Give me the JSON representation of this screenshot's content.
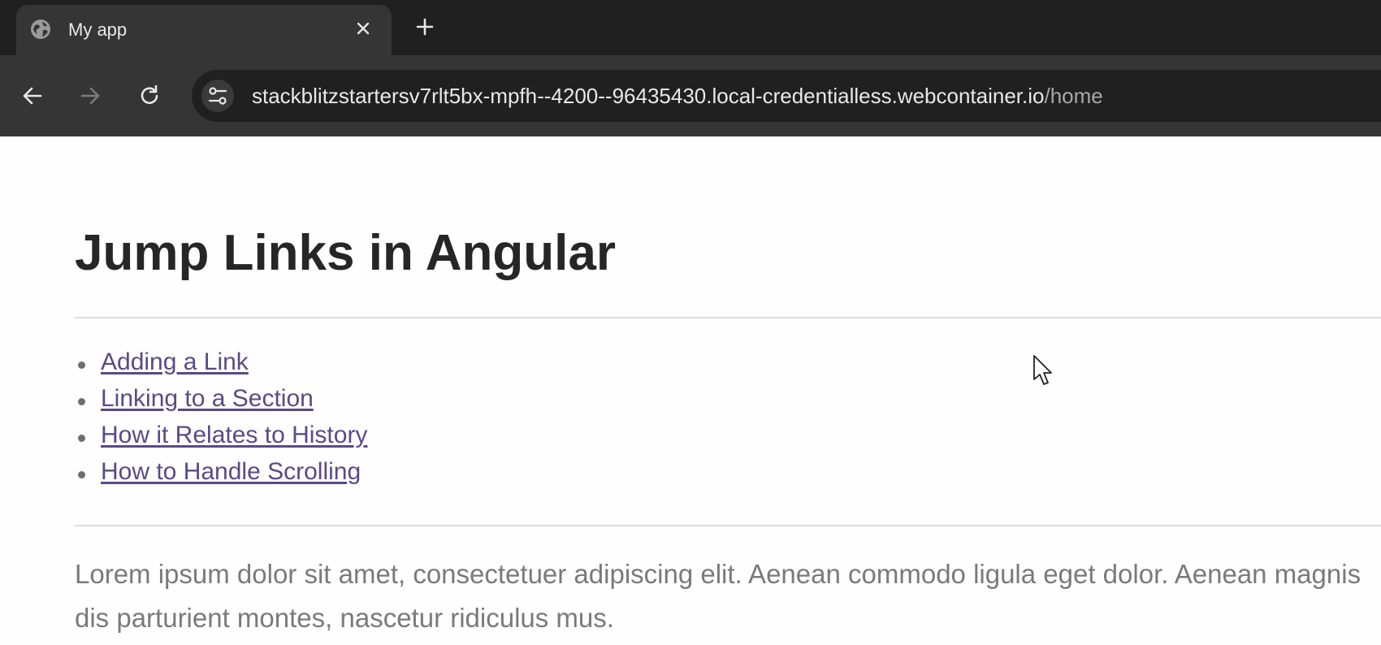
{
  "browser": {
    "tab": {
      "title": "My app",
      "favicon": "globe-icon",
      "close_icon": "close-icon"
    },
    "new_tab_icon": "plus-icon",
    "toolbar": {
      "back_icon": "arrow-left-icon",
      "forward_icon": "arrow-right-icon",
      "reload_icon": "reload-icon",
      "site_info_icon": "tune-icon",
      "url_host": "stackblitzstartersv7rlt5bx-mpfh--4200--96435430.local-credentialless.webcontainer.io",
      "url_path": "/home"
    }
  },
  "page": {
    "title": "Jump Links in Angular",
    "links": [
      {
        "label": "Adding a Link"
      },
      {
        "label": "Linking to a Section"
      },
      {
        "label": "How it Relates to History"
      },
      {
        "label": "How to Handle Scrolling"
      }
    ],
    "paragraph": "Lorem ipsum dolor sit amet, consectetuer adipiscing elit. Aenean commodo ligula eget dolor. Aenean magnis dis parturient montes, nascetur ridiculus mus."
  },
  "colors": {
    "tabstrip": "#202020",
    "toolbar": "#353535",
    "link": "#5a4a86",
    "body_text": "#7a7a7a",
    "heading": "#262626"
  }
}
